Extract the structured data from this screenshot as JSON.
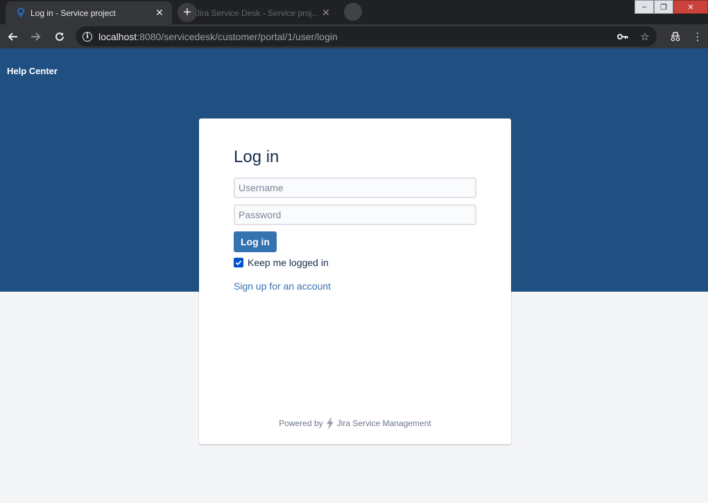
{
  "browser": {
    "active_tab": {
      "title": "Log in - Service project"
    },
    "inactive_tab": {
      "title": "Jira Service Desk - Service proj..."
    },
    "url_host": "localhost",
    "url_rest": ":8080/servicedesk/customer/portal/1/user/login",
    "window_controls": {
      "minimize": "–",
      "restore": "❐",
      "close": "✕"
    }
  },
  "header": {
    "help_center": "Help Center"
  },
  "login": {
    "title": "Log in",
    "username_placeholder": "Username",
    "password_placeholder": "Password",
    "submit_label": "Log in",
    "keep_logged_in_label": "Keep me logged in",
    "keep_logged_in_checked": true,
    "signup_link": "Sign up for an account"
  },
  "footer": {
    "powered_by": "Powered by",
    "product": "Jira Service Management"
  },
  "colors": {
    "hero": "#205081",
    "primary_button": "#3572b0",
    "checkbox": "#0052cc",
    "page_background": "#f4f5f7"
  },
  "icons": [
    "jira-favicon-icon",
    "close-icon",
    "plus-icon",
    "back-arrow-icon",
    "forward-arrow-icon",
    "reload-icon",
    "info-icon",
    "key-icon",
    "star-icon",
    "incognito-icon",
    "menu-dots-icon",
    "checkmark-icon",
    "bolt-icon"
  ]
}
